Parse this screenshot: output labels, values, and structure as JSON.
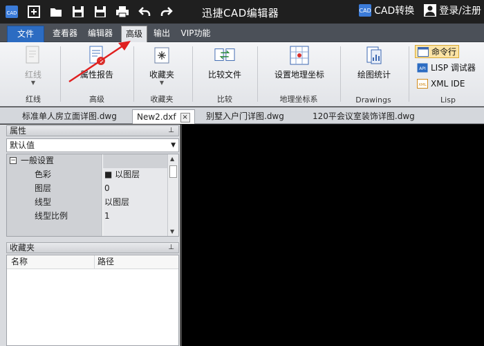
{
  "app": {
    "title": "迅捷CAD编辑器",
    "cad_convert": "CAD转换",
    "login": "登录/注册",
    "logo_text": "CAD",
    "cad_convert_icon_text": "CAD"
  },
  "quick_access": [
    "new-icon",
    "open-folder-icon",
    "save-icon",
    "save-as-pdf-icon",
    "print-icon",
    "undo-icon",
    "redo-icon"
  ],
  "menu": {
    "tabs": [
      "文件",
      "查看器",
      "编辑器",
      "高级",
      "输出",
      "VIP功能"
    ],
    "active": "高级"
  },
  "ribbon": {
    "redline": {
      "button": "红线",
      "group": "红线"
    },
    "advanced": {
      "button": "属性报告",
      "group": "高级"
    },
    "favorites": {
      "button": "收藏夹",
      "group": "收藏夹"
    },
    "compare": {
      "button": "比较文件",
      "group": "比较"
    },
    "geo": {
      "button": "设置地理坐标",
      "group": "地理坐标系"
    },
    "drawings": {
      "button": "绘图统计",
      "group": "Drawings"
    },
    "lisp": {
      "command_line": "命令行",
      "lisp_debugger": "LISP 调试器",
      "xml_ide": "XML IDE",
      "group": "Lisp",
      "api_icon_text": "API",
      "xml_icon_text": "XML"
    }
  },
  "doc_tabs": [
    {
      "label": "标准单人房立面详图.dwg",
      "active": false
    },
    {
      "label": "New2.dxf",
      "active": true,
      "close": "×"
    },
    {
      "label": "别墅入户门详图.dwg",
      "active": false
    },
    {
      "label": "120平会议室装饰详图.dwg",
      "active": false
    }
  ],
  "properties": {
    "title": "属性",
    "selected": "默认值",
    "category": "一般设置",
    "expander": "−",
    "pin": "⊥",
    "rows": [
      {
        "name": "色彩",
        "value": "■ 以图层"
      },
      {
        "name": "图层",
        "value": "0"
      },
      {
        "name": "线型",
        "value": "以图层"
      },
      {
        "name": "线型比例",
        "value": "1"
      }
    ]
  },
  "favorites": {
    "title": "收藏夹",
    "pin": "⊥",
    "columns": [
      "名称",
      "路径"
    ]
  },
  "colors": {
    "titlebar": "#1f1f1f",
    "file_tab": "#2c6cc2",
    "annotation_arrow": "#e02020",
    "command_line_highlight": "#fbe3a5"
  }
}
